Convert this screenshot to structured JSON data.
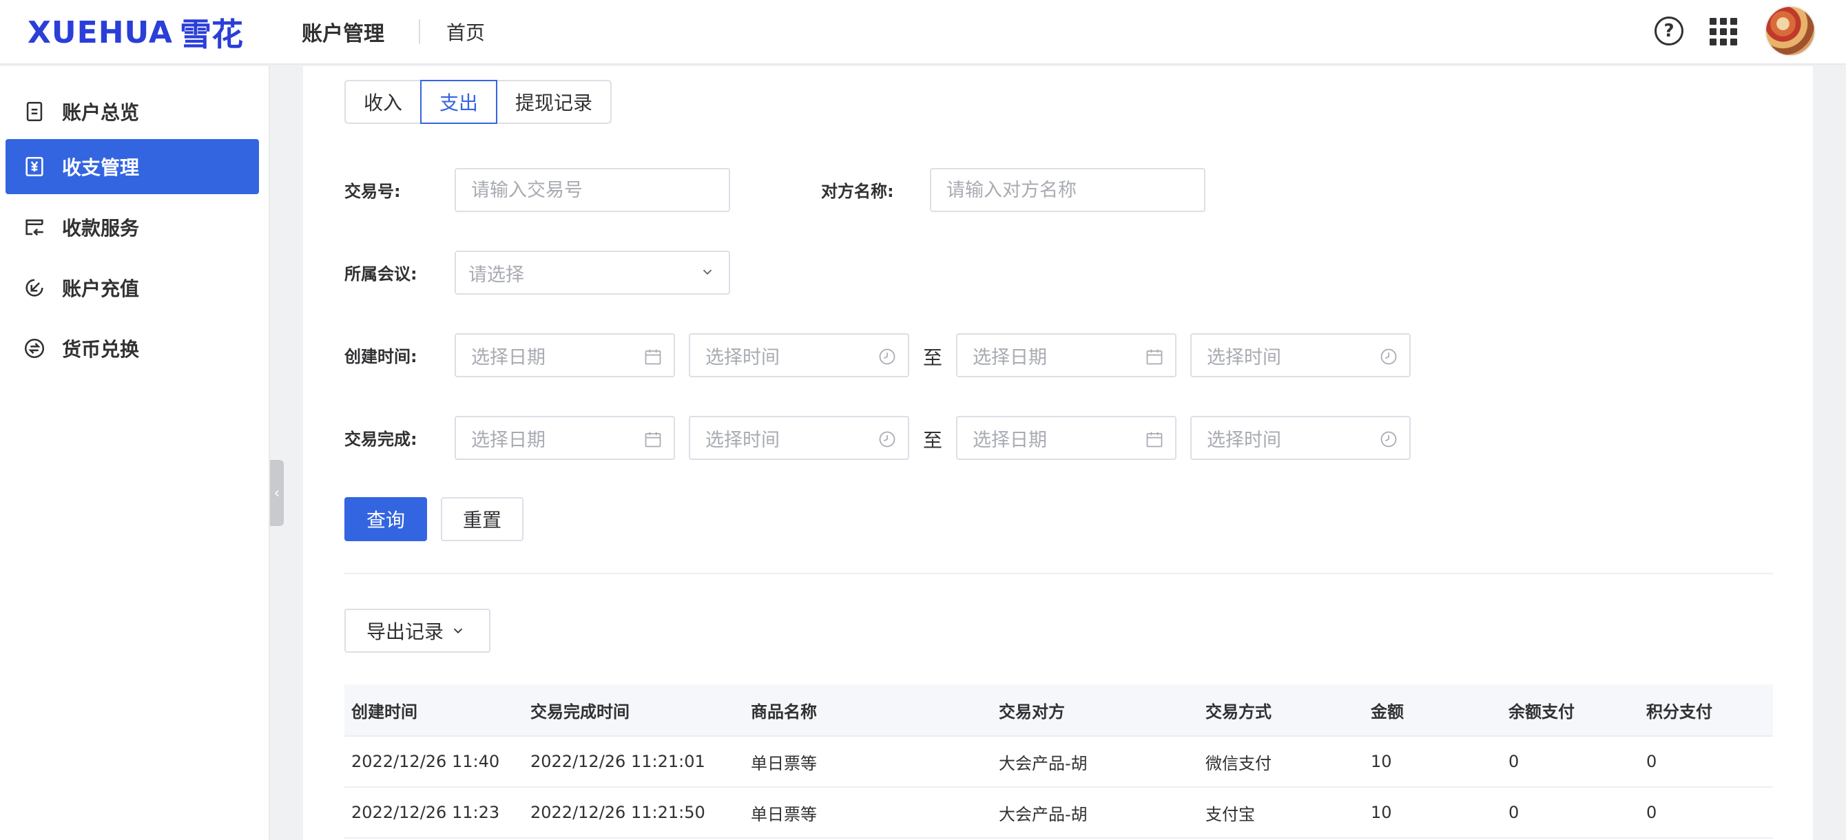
{
  "brand": {
    "latin": "XUEHUA",
    "cjk": "雪花",
    "color": "#2a3ed8"
  },
  "header": {
    "title": "账户管理",
    "home_link": "首页",
    "help_icon": "help-circle-icon",
    "apps_icon": "grid-apps-icon"
  },
  "sidebar": {
    "items": [
      {
        "label": "账户总览",
        "icon": "document-icon",
        "active": false
      },
      {
        "label": "收支管理",
        "icon": "yen-icon",
        "active": true
      },
      {
        "label": "收款服务",
        "icon": "receive-payment-icon",
        "active": false
      },
      {
        "label": "账户充值",
        "icon": "recharge-icon",
        "active": false
      },
      {
        "label": "货币兑换",
        "icon": "exchange-icon",
        "active": false
      }
    ],
    "accent_color": "#3465e1"
  },
  "tabs": [
    {
      "label": "收入",
      "active": false
    },
    {
      "label": "支出",
      "active": true
    },
    {
      "label": "提现记录",
      "active": false
    }
  ],
  "filters": {
    "trade_no": {
      "label": "交易号:",
      "placeholder": "请输入交易号",
      "value": ""
    },
    "counterparty": {
      "label": "对方名称:",
      "placeholder": "请输入对方名称",
      "value": ""
    },
    "meeting": {
      "label": "所属会议:",
      "placeholder": "请选择"
    },
    "created": {
      "label": "创建时间:",
      "date_placeholder": "选择日期",
      "time_placeholder": "选择时间",
      "separator": "至"
    },
    "completed": {
      "label": "交易完成:",
      "date_placeholder": "选择日期",
      "time_placeholder": "选择时间",
      "separator": "至"
    }
  },
  "actions": {
    "query": "查询",
    "reset": "重置",
    "export": "导出记录"
  },
  "table": {
    "columns": [
      "创建时间",
      "交易完成时间",
      "商品名称",
      "交易对方",
      "交易方式",
      "金额",
      "余额支付",
      "积分支付"
    ],
    "rows": [
      [
        "2022/12/26 11:40",
        "2022/12/26 11:21:01",
        "单日票等",
        "大会产品-胡",
        "微信支付",
        "10",
        "0",
        "0"
      ],
      [
        "2022/12/26 11:23",
        "2022/12/26 11:21:50",
        "单日票等",
        "大会产品-胡",
        "支付宝",
        "10",
        "0",
        "0"
      ]
    ]
  }
}
